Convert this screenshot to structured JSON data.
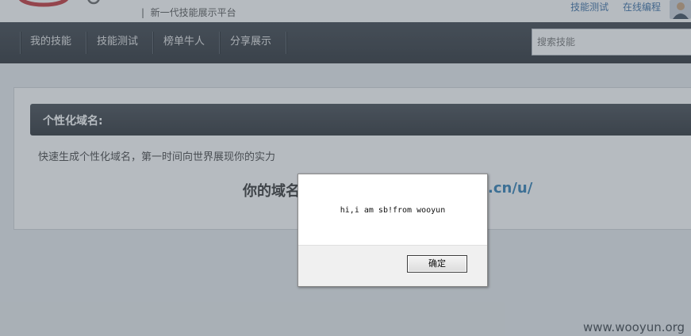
{
  "header": {
    "tagline": "新一代技能展示平台",
    "links": [
      "技能测试",
      "在线编程"
    ]
  },
  "nav": {
    "items": [
      "我的技能",
      "技能测试",
      "榜单牛人",
      "分享展示"
    ],
    "search_placeholder": "搜索技能"
  },
  "main": {
    "section_title": "个性化域名:",
    "description": "快速生成个性化域名，第一时间向世界展现你的实力",
    "domain_prefix": "你的域名",
    "domain_suffix": ".cn/u/"
  },
  "dialog": {
    "message": "hi,i am sb!from wooyun",
    "ok_label": "确定"
  },
  "watermark": "www.wooyun.org"
}
